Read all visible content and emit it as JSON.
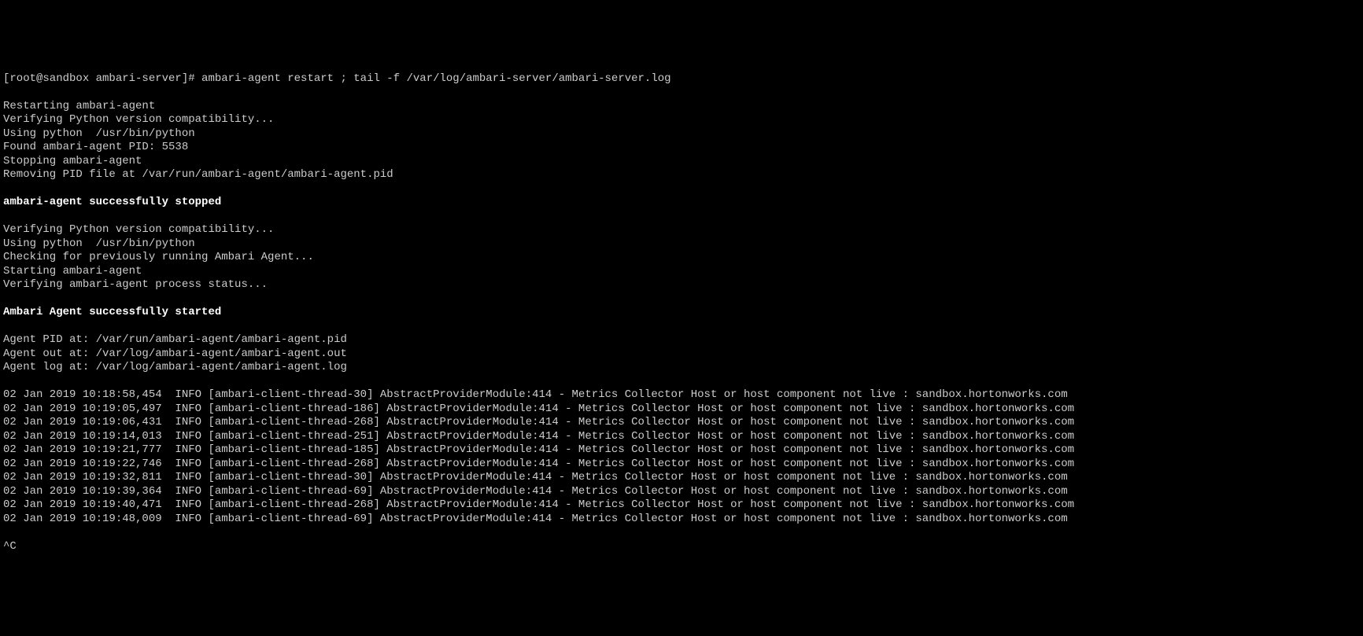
{
  "prompt": "[root@sandbox ambari-server]# ambari-agent restart ; tail -f /var/log/ambari-server/ambari-server.log",
  "lines": [
    "Restarting ambari-agent",
    "Verifying Python version compatibility...",
    "Using python  /usr/bin/python",
    "Found ambari-agent PID: 5538",
    "Stopping ambari-agent",
    "Removing PID file at /var/run/ambari-agent/ambari-agent.pid"
  ],
  "stopped_msg": "ambari-agent successfully stopped",
  "lines2": [
    "Verifying Python version compatibility...",
    "Using python  /usr/bin/python",
    "Checking for previously running Ambari Agent...",
    "Starting ambari-agent",
    "Verifying ambari-agent process status..."
  ],
  "started_msg": "Ambari Agent successfully started",
  "lines3": [
    "Agent PID at: /var/run/ambari-agent/ambari-agent.pid",
    "Agent out at: /var/log/ambari-agent/ambari-agent.out",
    "Agent log at: /var/log/ambari-agent/ambari-agent.log"
  ],
  "log_entries": [
    "02 Jan 2019 10:18:58,454  INFO [ambari-client-thread-30] AbstractProviderModule:414 - Metrics Collector Host or host component not live : sandbox.hortonworks.com",
    "02 Jan 2019 10:19:05,497  INFO [ambari-client-thread-186] AbstractProviderModule:414 - Metrics Collector Host or host component not live : sandbox.hortonworks.com",
    "02 Jan 2019 10:19:06,431  INFO [ambari-client-thread-268] AbstractProviderModule:414 - Metrics Collector Host or host component not live : sandbox.hortonworks.com",
    "02 Jan 2019 10:19:14,013  INFO [ambari-client-thread-251] AbstractProviderModule:414 - Metrics Collector Host or host component not live : sandbox.hortonworks.com",
    "02 Jan 2019 10:19:21,777  INFO [ambari-client-thread-185] AbstractProviderModule:414 - Metrics Collector Host or host component not live : sandbox.hortonworks.com",
    "02 Jan 2019 10:19:22,746  INFO [ambari-client-thread-268] AbstractProviderModule:414 - Metrics Collector Host or host component not live : sandbox.hortonworks.com",
    "02 Jan 2019 10:19:32,811  INFO [ambari-client-thread-30] AbstractProviderModule:414 - Metrics Collector Host or host component not live : sandbox.hortonworks.com",
    "02 Jan 2019 10:19:39,364  INFO [ambari-client-thread-69] AbstractProviderModule:414 - Metrics Collector Host or host component not live : sandbox.hortonworks.com",
    "02 Jan 2019 10:19:40,471  INFO [ambari-client-thread-268] AbstractProviderModule:414 - Metrics Collector Host or host component not live : sandbox.hortonworks.com",
    "02 Jan 2019 10:19:48,009  INFO [ambari-client-thread-69] AbstractProviderModule:414 - Metrics Collector Host or host component not live : sandbox.hortonworks.com"
  ],
  "interrupt": "^C"
}
